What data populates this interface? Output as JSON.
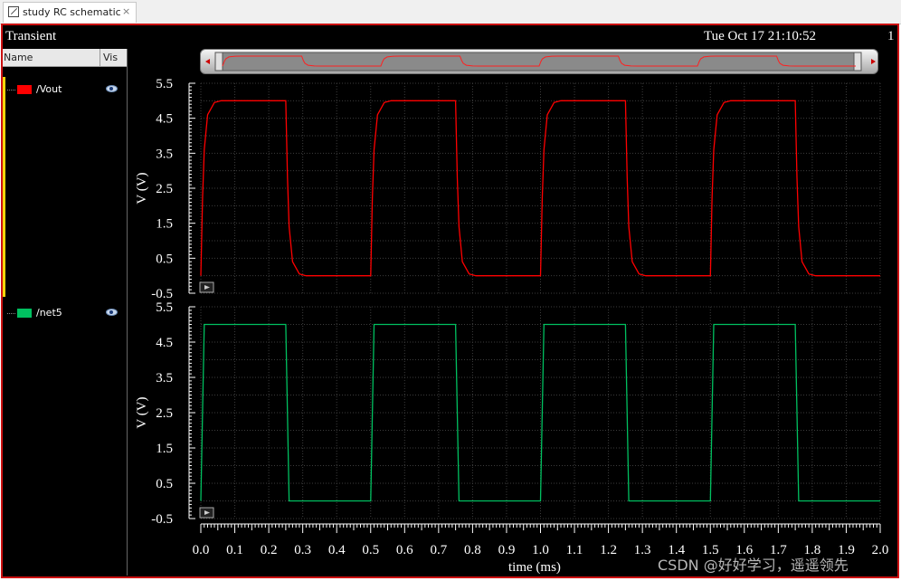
{
  "tab": {
    "label": "study RC schematic",
    "close_label": "×"
  },
  "window": {
    "title": "Transient",
    "timestamp": "Tue Oct 17 21:10:52",
    "subwindow_index": "1"
  },
  "legend": {
    "col_name": "Name",
    "col_vis": "Vis",
    "items": [
      {
        "name": "/Vout",
        "color": "#ff0000",
        "icon": "eye-icon"
      },
      {
        "name": "/net5",
        "color": "#00c060",
        "icon": "eye-icon"
      }
    ]
  },
  "watermark": "CSDN @好好学习，遥遥领先",
  "chart_data": [
    {
      "type": "line",
      "title": "",
      "xlabel": "time (ms)",
      "ylabel": "V (V)",
      "xlim": [
        0.0,
        2.0
      ],
      "ylim": [
        -0.5,
        5.5
      ],
      "xticks": [
        "0.0",
        "0.1",
        "0.2",
        "0.3",
        "0.4",
        "0.5",
        "0.6",
        "0.7",
        "0.8",
        "0.9",
        "1.0",
        "1.1",
        "1.2",
        "1.3",
        "1.4",
        "1.5",
        "1.6",
        "1.7",
        "1.8",
        "1.9",
        "2.0"
      ],
      "yticks": [
        "5.5",
        "4.5",
        "3.5",
        "2.5",
        "1.5",
        "0.5",
        "-0.5"
      ],
      "grid": true,
      "series": [
        {
          "name": "/Vout",
          "color": "#ff0000",
          "x": [
            0.0,
            0.005,
            0.01,
            0.02,
            0.04,
            0.06,
            0.25,
            0.255,
            0.26,
            0.27,
            0.29,
            0.31,
            0.5,
            0.505,
            0.51,
            0.52,
            0.54,
            0.56,
            0.75,
            0.755,
            0.76,
            0.77,
            0.79,
            0.81,
            1.0,
            1.005,
            1.01,
            1.02,
            1.04,
            1.06,
            1.25,
            1.255,
            1.26,
            1.27,
            1.29,
            1.31,
            1.5,
            1.505,
            1.51,
            1.52,
            1.54,
            1.56,
            1.75,
            1.755,
            1.76,
            1.77,
            1.79,
            1.81,
            2.0
          ],
          "y": [
            0.0,
            2.2,
            3.6,
            4.6,
            4.95,
            5.0,
            5.0,
            2.8,
            1.4,
            0.4,
            0.05,
            0.0,
            0.0,
            2.2,
            3.6,
            4.6,
            4.95,
            5.0,
            5.0,
            2.8,
            1.4,
            0.4,
            0.05,
            0.0,
            0.0,
            2.2,
            3.6,
            4.6,
            4.95,
            5.0,
            5.0,
            2.8,
            1.4,
            0.4,
            0.05,
            0.0,
            0.0,
            2.2,
            3.6,
            4.6,
            4.95,
            5.0,
            5.0,
            2.8,
            1.4,
            0.4,
            0.05,
            0.0,
            0.0
          ]
        },
        {
          "name": "/net5",
          "color": "#00c060",
          "x": [
            0.0,
            0.01,
            0.25,
            0.26,
            0.5,
            0.51,
            0.75,
            0.76,
            1.0,
            1.01,
            1.25,
            1.26,
            1.5,
            1.51,
            1.75,
            1.76,
            2.0
          ],
          "y": [
            0.0,
            5.0,
            5.0,
            0.0,
            0.0,
            5.0,
            5.0,
            0.0,
            0.0,
            5.0,
            5.0,
            0.0,
            0.0,
            5.0,
            5.0,
            0.0,
            0.0
          ]
        }
      ]
    }
  ]
}
